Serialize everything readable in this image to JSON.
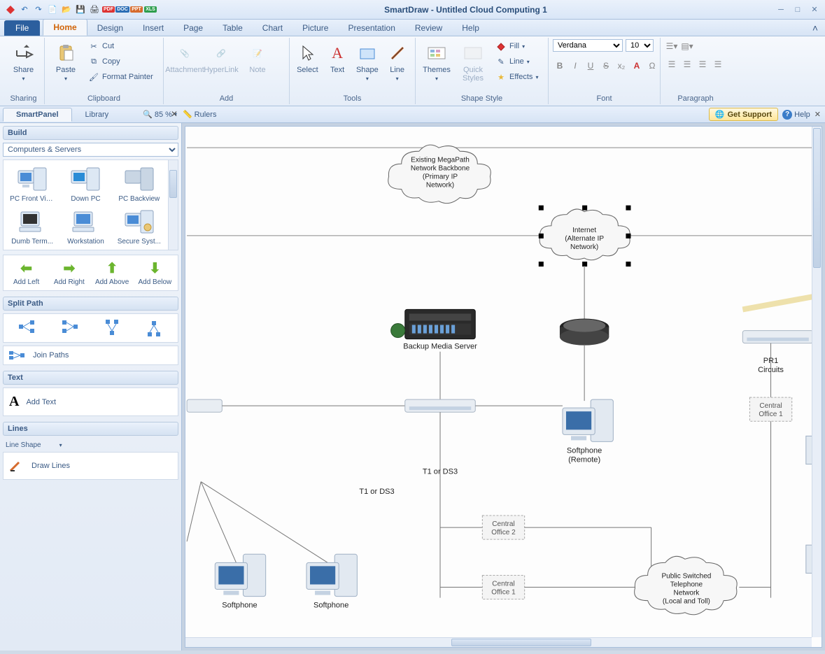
{
  "app": {
    "title": "SmartDraw - Untitled Cloud Computing 1"
  },
  "tabs": {
    "file": "File",
    "items": [
      "Home",
      "Design",
      "Insert",
      "Page",
      "Table",
      "Chart",
      "Picture",
      "Presentation",
      "Review",
      "Help"
    ],
    "active": "Home"
  },
  "ribbon": {
    "sharing": {
      "share": "Share",
      "label": "Sharing"
    },
    "clipboard": {
      "paste": "Paste",
      "cut": "Cut",
      "copy": "Copy",
      "fmtpainter": "Format Painter",
      "label": "Clipboard"
    },
    "add": {
      "attachment": "Attachment",
      "hyperlink": "HyperLink",
      "note": "Note",
      "label": "Add"
    },
    "tools": {
      "select": "Select",
      "text": "Text",
      "shape": "Shape",
      "line": "Line",
      "label": "Tools"
    },
    "shapestyle": {
      "themes": "Themes",
      "quickstyles": "Quick Styles",
      "fill": "Fill",
      "line": "Line",
      "effects": "Effects",
      "label": "Shape Style"
    },
    "font": {
      "name": "Verdana",
      "size": "10",
      "label": "Font"
    },
    "paragraph": {
      "label": "Paragraph"
    }
  },
  "doctabs": {
    "smartpanel": "SmartPanel",
    "library": "Library",
    "zoom": "85 %",
    "rulers": "Rulers",
    "getsupport": "Get Support",
    "help": "Help"
  },
  "sidepanel": {
    "build": "Build",
    "category": "Computers & Servers",
    "shapes": [
      "PC Front View",
      "Down PC",
      "PC Backview",
      "Dumb Term...",
      "Workstation",
      "Secure Syst..."
    ],
    "addbtns": [
      "Add Left",
      "Add Right",
      "Add Above",
      "Add Below"
    ],
    "splitpath": "Split Path",
    "joinpaths": "Join Paths",
    "text": "Text",
    "addtext": "Add Text",
    "lines": "Lines",
    "lineshape": "Line Shape",
    "drawlines": "Draw Lines"
  },
  "diagram": {
    "cloud1": "Existing MegaPath Network Backbone (Primary IP Network)",
    "cloud1_l1": "Existing MegaPath",
    "cloud1_l2": "Network Backbone",
    "cloud1_l3": "(Primary IP",
    "cloud1_l4": "Network)",
    "cloud2": "Internet (Alternate IP Network)",
    "cloud2_l1": "Internet",
    "cloud2_l2": "(Alternate IP",
    "cloud2_l3": "Network)",
    "cloud3_l1": "Public Switched",
    "cloud3_l2": "Telephone",
    "cloud3_l3": "Network",
    "cloud3_l4": "(Local and Toll)",
    "backup": "Backup Media Server",
    "softphone_remote_l1": "Softphone",
    "softphone_remote_l2": "(Remote)",
    "softphone": "Softphone",
    "t1ds3": "T1 or DS3",
    "co1": "Central Office 1",
    "co1_l1": "Central",
    "co1_l2": "Office 1",
    "co2": "Central Office 2",
    "co2_l1": "Central",
    "co2_l2": "Office 2",
    "pr1_l1": "PR1",
    "pr1_l2": "Circuits"
  }
}
